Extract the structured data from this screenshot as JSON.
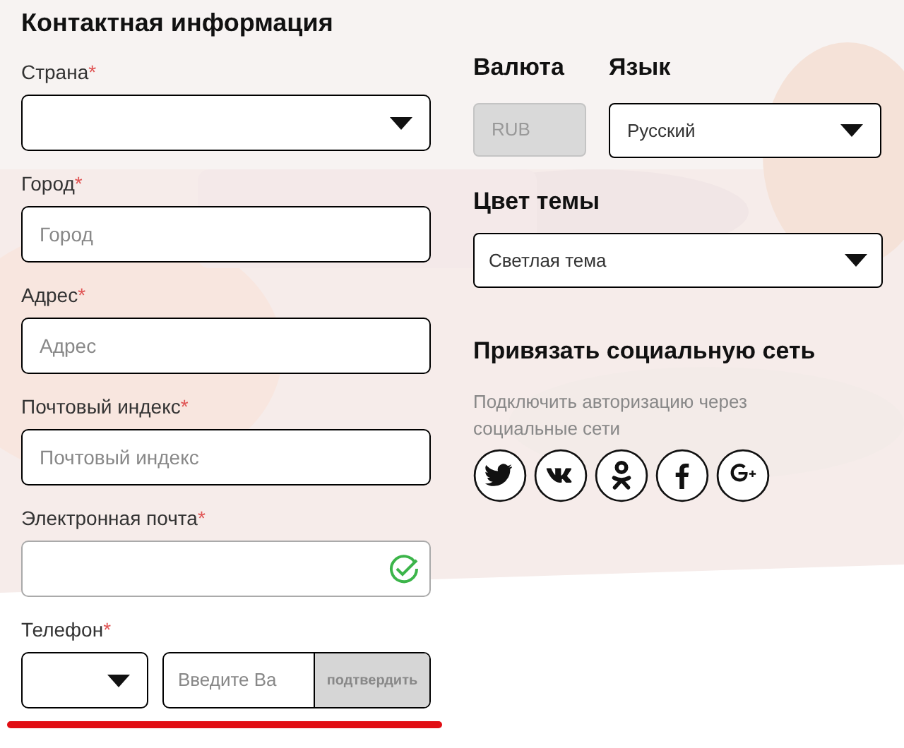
{
  "title": "Контактная информация",
  "fields": [
    {
      "kind": "select",
      "label": "Страна",
      "mark": "*"
    },
    {
      "kind": "text",
      "label": "Город",
      "mark": "*",
      "placeholder": "Город"
    },
    {
      "kind": "text",
      "label": "Адрес",
      "mark": "*",
      "placeholder": "Адрес"
    },
    {
      "kind": "text",
      "label": "Почтовый индекс",
      "mark": "*",
      "placeholder": "Почтовый индекс"
    },
    {
      "kind": "email",
      "label": "Электронная почта",
      "mark": "*",
      "valid": true
    },
    {
      "kind": "phone",
      "label": "Телефон",
      "mark": "*",
      "placeholder": "Введите Ва",
      "button": "подтвердить",
      "button_disabled": true
    }
  ],
  "currency": {
    "label": "Валюта",
    "value": "RUB",
    "disabled": true
  },
  "language": {
    "label": "Язык",
    "value": "Русский"
  },
  "theme": {
    "label": "Цвет темы",
    "value": "Светлая тема"
  },
  "social": {
    "title": "Привязать социальную сеть",
    "description": "Подключить авторизацию через социальные сети",
    "networks": [
      {
        "kind": "twitter"
      },
      {
        "kind": "vk"
      },
      {
        "kind": "ok"
      },
      {
        "kind": "facebook"
      },
      {
        "kind": "gplus"
      }
    ]
  }
}
